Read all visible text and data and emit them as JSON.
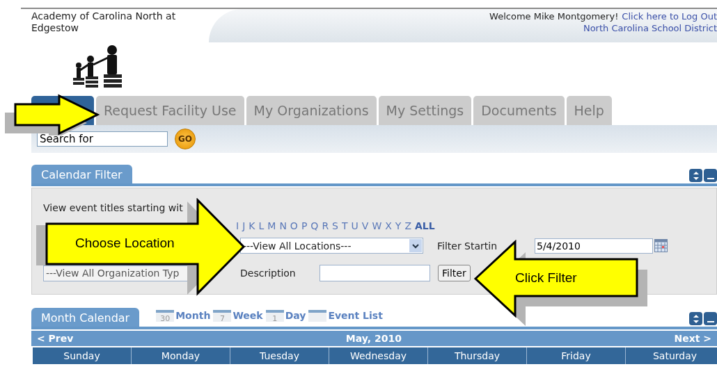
{
  "header": {
    "school_name": "Academy of Carolina North at Edgestow",
    "welcome": "Welcome Mike Montgomery!",
    "logout_link": "Click here to Log Out",
    "district_link": "North Carolina School District"
  },
  "tabs": [
    {
      "selected": true
    },
    {
      "label": "Request Facility Use",
      "selected": false
    },
    {
      "label": "My Organizations",
      "selected": false
    },
    {
      "label": "My Settings",
      "selected": false
    },
    {
      "label": "Documents",
      "selected": false
    },
    {
      "label": "Help",
      "selected": false
    }
  ],
  "search": {
    "value": "Search for",
    "button": "GO"
  },
  "calendar_filter": {
    "title": "Calendar Filter",
    "intro": "View event titles starting wit",
    "letters": [
      "I",
      "J",
      "K",
      "L",
      "M",
      "N",
      "O",
      "P",
      "Q",
      "R",
      "S",
      "T",
      "U",
      "V",
      "W",
      "X",
      "Y",
      "Z"
    ],
    "all_link": "ALL",
    "location_select": "---View All Locations---",
    "filter_start_label": "Filter Startin",
    "filter_start_value": "5/4/2010",
    "org_type_select": "---View All Organization Typ",
    "description_label": "Description",
    "filter_button": "Filter"
  },
  "month_calendar": {
    "title": "Month Calendar",
    "views": [
      {
        "label": "Month",
        "icon_text": "30"
      },
      {
        "label": "Week",
        "icon_text": "7"
      },
      {
        "label": "Day",
        "icon_text": "1"
      },
      {
        "label": "Event List"
      }
    ],
    "prev": "< Prev",
    "month": "May, 2010",
    "next": "Next >",
    "weekdays": [
      "Sunday",
      "Monday",
      "Tuesday",
      "Wednesday",
      "Thursday",
      "Friday",
      "Saturday"
    ]
  },
  "callouts": [
    {
      "kind": "right"
    },
    {
      "text": "Choose Location",
      "kind": "right"
    },
    {
      "text": "Click Filter",
      "kind": "left"
    }
  ]
}
